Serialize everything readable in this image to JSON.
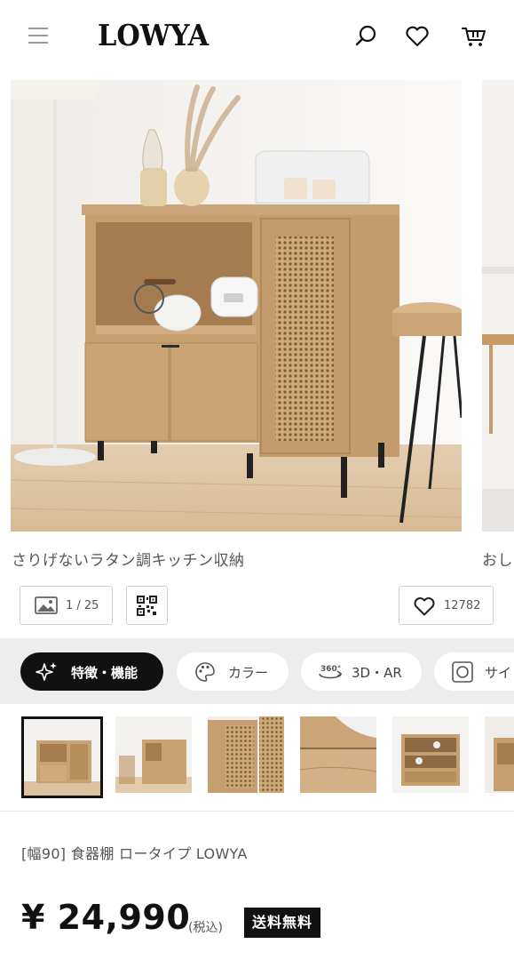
{
  "header": {
    "logo": "LOWYA",
    "menu_icon": "hamburger-menu-icon",
    "search_icon": "search-icon",
    "favorite_icon": "heart-icon",
    "cart_icon": "cart-icon"
  },
  "hero": {
    "caption_main": "さりげないラタン調キッチン収納",
    "caption_next": "おし"
  },
  "actions": {
    "image_counter": "1 / 25",
    "qr_icon": "qr-code-icon",
    "favorite_count": "12782"
  },
  "tabs": [
    {
      "label": "特徴・機能",
      "icon": "sparkle-icon",
      "active": true
    },
    {
      "label": "カラー",
      "icon": "palette-icon",
      "active": false
    },
    {
      "label": "3D・AR",
      "icon": "360-view-icon",
      "badge": "360°",
      "active": false
    },
    {
      "label": "サイ",
      "icon": "size-icon",
      "active": false
    }
  ],
  "thumbnails": {
    "count_visible": 6,
    "selected_index": 0
  },
  "product": {
    "title": "[幅90] 食器棚 ロータイプ LOWYA",
    "price": "¥ 24,990",
    "tax_note": "(税込)",
    "shipping_badge": "送料無料"
  },
  "colors": {
    "wood": "#c9a579",
    "rattan": "#b48f5c",
    "dark": "#111111",
    "tab_bar_bg": "#ededed"
  }
}
